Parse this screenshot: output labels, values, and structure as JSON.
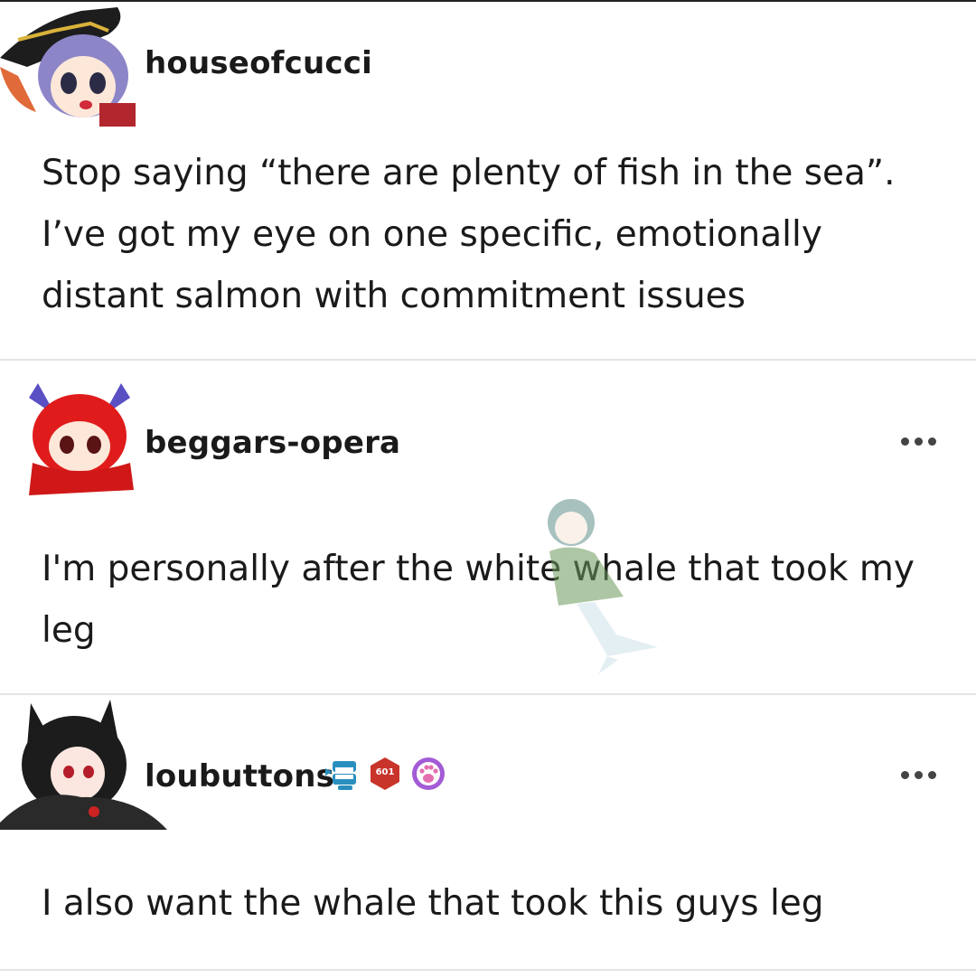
{
  "posts": [
    {
      "username": "houseofcucci",
      "lines": [
        "Stop saying “there are plenty of fish in the sea”.",
        "I’ve got my eye on one specific, emotionally",
        "distant salmon with commitment issues"
      ],
      "avatar_icon": "witch-girl-avatar-icon"
    },
    {
      "username": "beggars-opera",
      "lines": [
        "I'm personally after the white whale that took my",
        "leg"
      ],
      "avatar_icon": "red-haired-girl-avatar-icon",
      "menu_icon": "more-options-icon"
    },
    {
      "username": "loubuttons",
      "lines": [
        "I also want the whale that took this guys leg"
      ],
      "avatar_icon": "cat-eared-girl-avatar-icon",
      "menu_icon": "more-options-icon",
      "badges": [
        {
          "icon": "wind-up-teeth-badge-icon"
        },
        {
          "icon": "count-badge-icon",
          "text": "601"
        },
        {
          "icon": "paw-badge-icon"
        }
      ]
    }
  ],
  "colors": {
    "text": "#1a1a1a",
    "divider": "#e4e4e4",
    "badge_red": "#c8342a",
    "badge_purple": "#a35bd6",
    "badge_teal": "#2a8fbf"
  }
}
